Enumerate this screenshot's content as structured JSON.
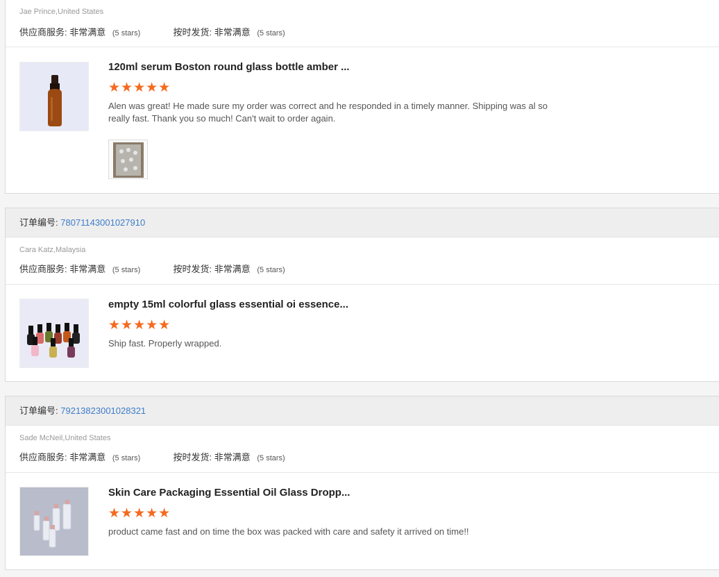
{
  "reviews": [
    {
      "order_label": "",
      "order_number": "",
      "buyer": "Jae Prince,United States",
      "supplier_label": "供应商服务:",
      "supplier_value": "非常满意",
      "supplier_stars": "(5 stars)",
      "shipping_label": "按时发货:",
      "shipping_value": "非常满意",
      "shipping_stars": "(5 stars)",
      "product_title": "120ml serum Boston round glass bottle amber ...",
      "product_image": "amber-dropper-bottle",
      "rating": "★★★★★",
      "text": "Alen was great! He made sure my order was correct and he responded in a timely manner. Shipping was al so really fast. Thank you so much! Can't wait to order again.",
      "photo": "box-of-bottles-photo"
    },
    {
      "order_label": "订单编号:",
      "order_number": "78071143001027910",
      "buyer": "Cara Katz,Malaysia",
      "supplier_label": "供应商服务:",
      "supplier_value": "非常满意",
      "supplier_stars": "(5 stars)",
      "shipping_label": "按时发货:",
      "shipping_value": "非常满意",
      "shipping_stars": "(5 stars)",
      "product_title": "empty 15ml colorful glass essential oi essence...",
      "product_image": "colorful-dropper-bottles",
      "rating": "★★★★★",
      "text": "Ship fast. Properly wrapped."
    },
    {
      "order_label": "订单编号:",
      "order_number": "79213823001028321",
      "buyer": "Sade McNeil,United States",
      "supplier_label": "供应商服务:",
      "supplier_value": "非常满意",
      "supplier_stars": "(5 stars)",
      "shipping_label": "按时发货:",
      "shipping_value": "非常满意",
      "shipping_stars": "(5 stars)",
      "product_title": "Skin Care Packaging Essential Oil Glass Dropp...",
      "product_image": "clear-dropper-bottles",
      "rating": "★★★★★",
      "text": "product came fast and on time the box was packed with care and safety it arrived on time!!"
    }
  ],
  "colors": {
    "star": "#f46a1f",
    "order_link": "#3d7cc9",
    "header_bg": "#eeeeee"
  }
}
